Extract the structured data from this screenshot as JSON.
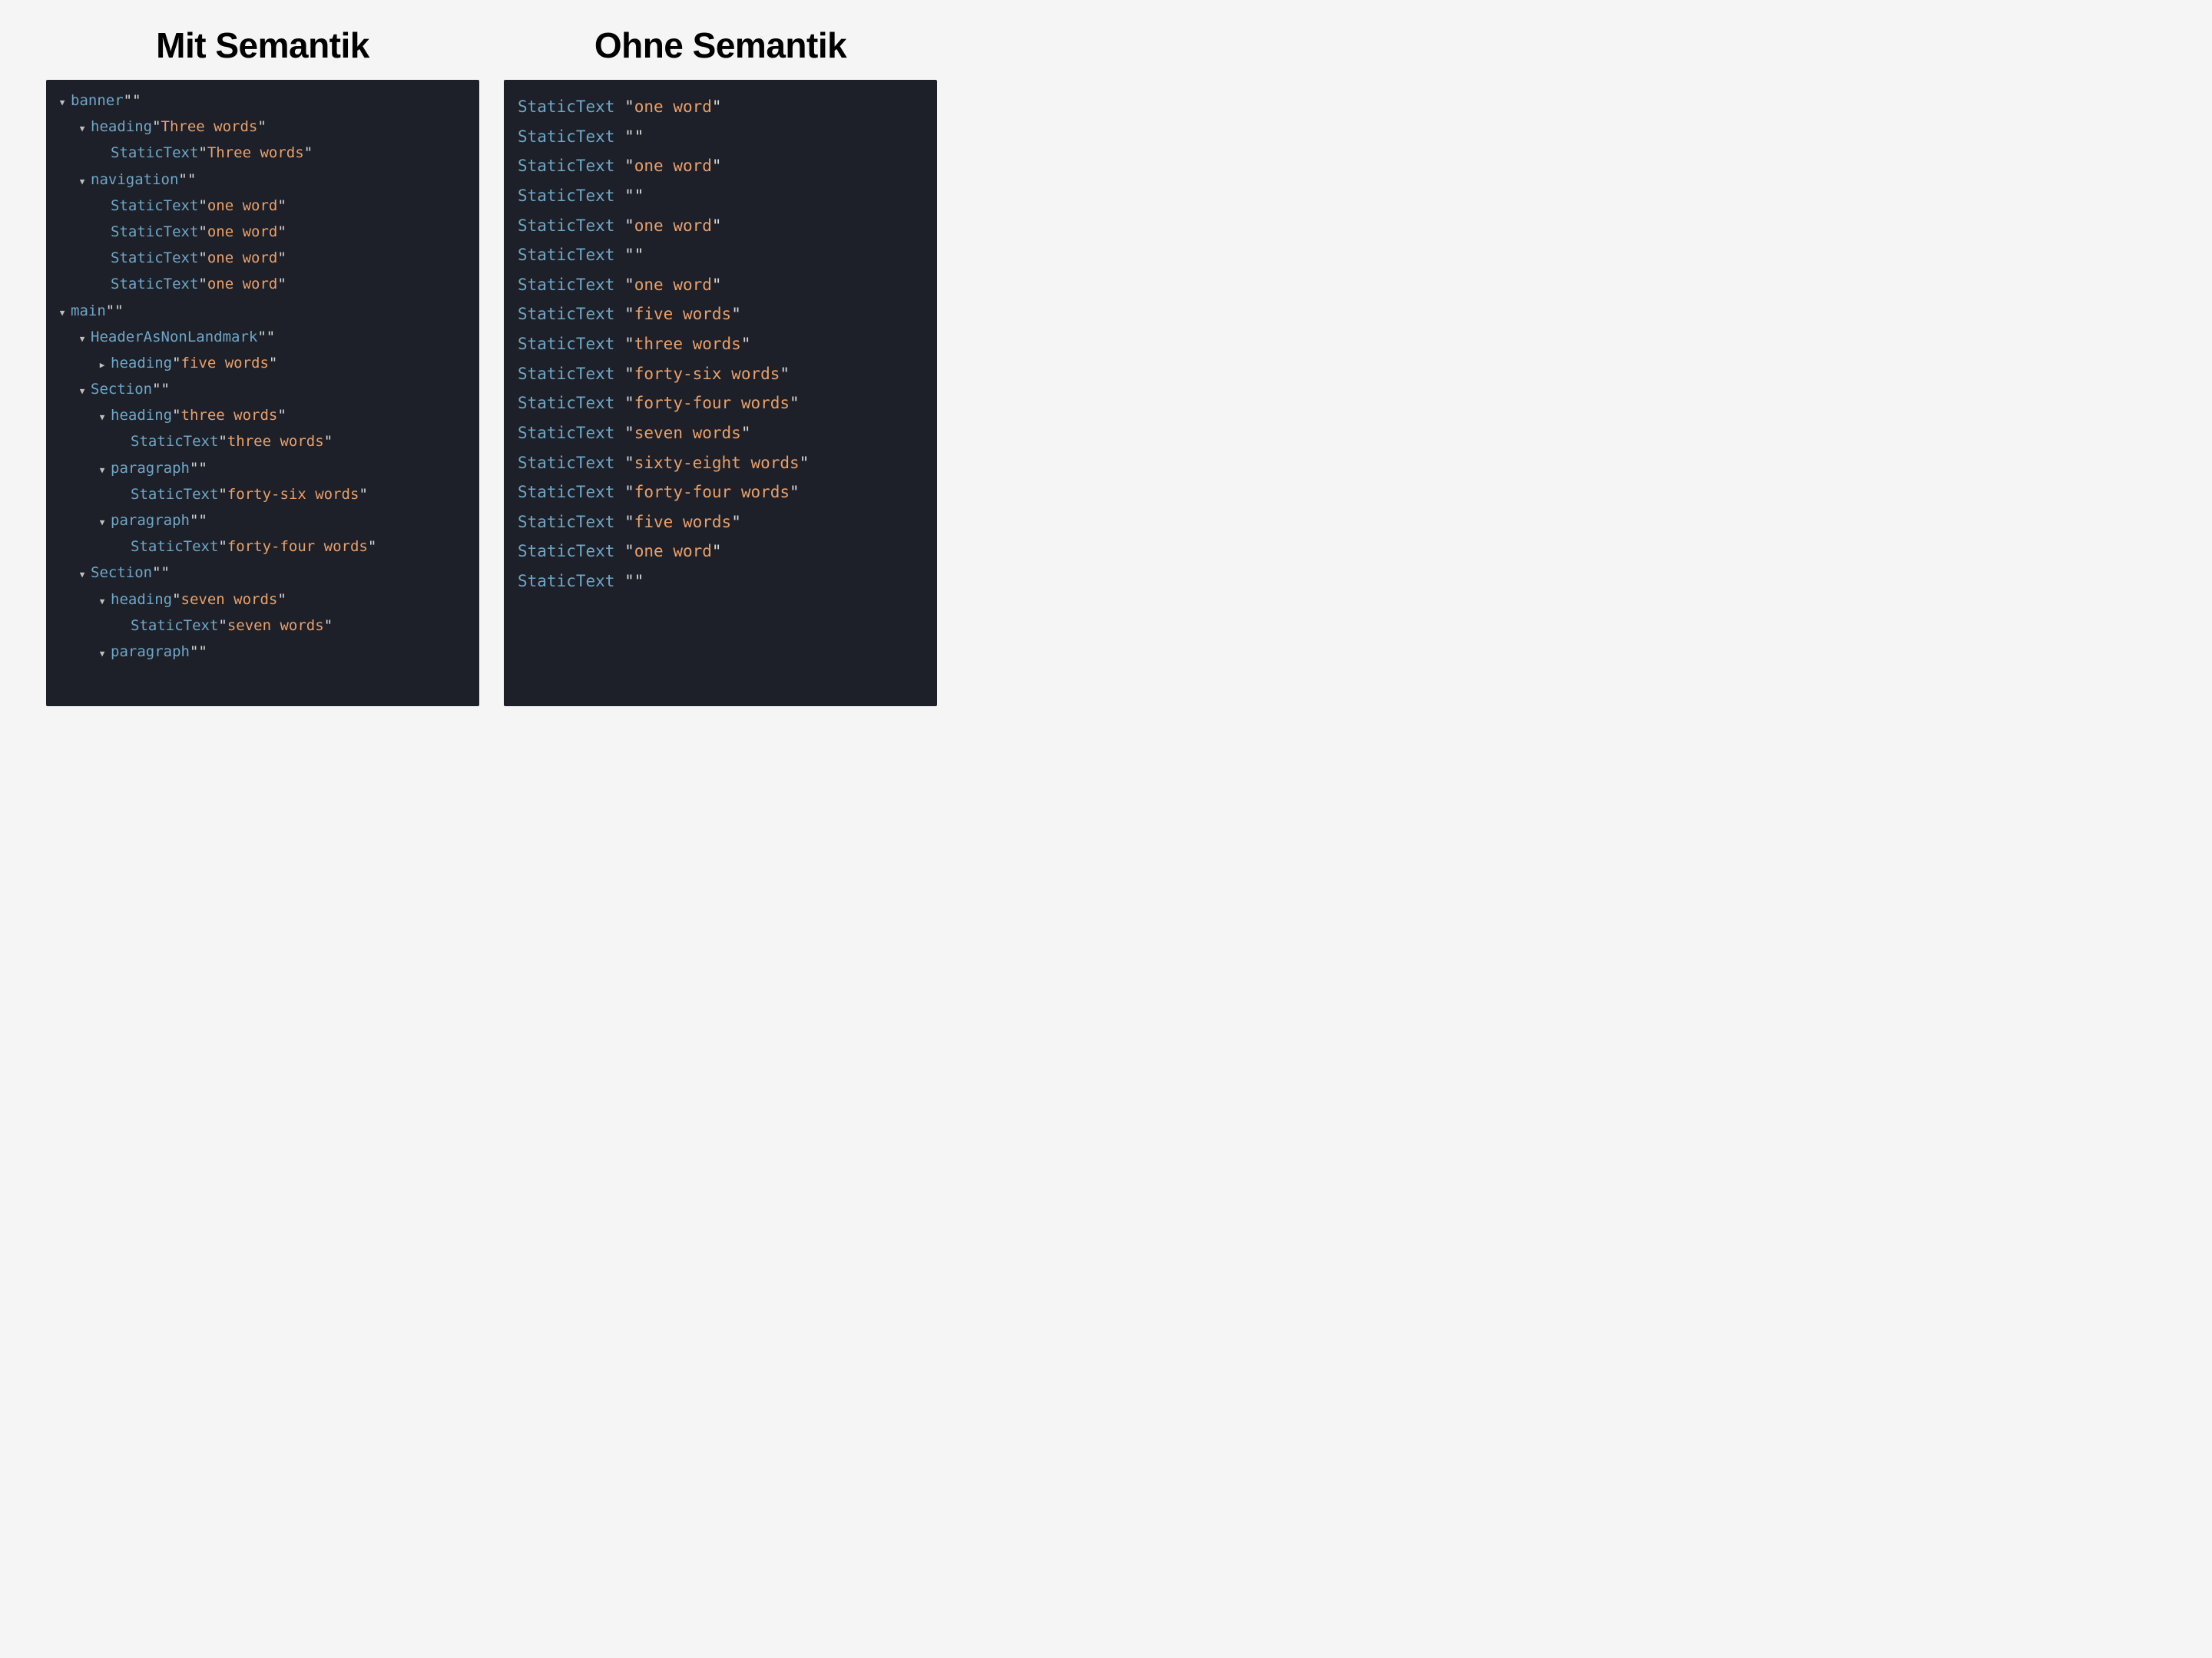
{
  "left": {
    "title": "Mit Semantik",
    "rows": [
      {
        "indent": 0,
        "disclosure": "down",
        "role": "banner",
        "value": ""
      },
      {
        "indent": 1,
        "disclosure": "down",
        "role": "heading",
        "value": "Three words"
      },
      {
        "indent": 2,
        "disclosure": "none",
        "role": "StaticText",
        "value": "Three words"
      },
      {
        "indent": 1,
        "disclosure": "down",
        "role": "navigation",
        "value": ""
      },
      {
        "indent": 2,
        "disclosure": "none",
        "role": "StaticText",
        "value": "one word"
      },
      {
        "indent": 2,
        "disclosure": "none",
        "role": "StaticText",
        "value": "one word"
      },
      {
        "indent": 2,
        "disclosure": "none",
        "role": "StaticText",
        "value": "one word"
      },
      {
        "indent": 2,
        "disclosure": "none",
        "role": "StaticText",
        "value": "one word"
      },
      {
        "indent": 0,
        "disclosure": "down",
        "role": "main",
        "value": ""
      },
      {
        "indent": 1,
        "disclosure": "down",
        "role": "HeaderAsNonLandmark",
        "value": ""
      },
      {
        "indent": 2,
        "disclosure": "right",
        "role": "heading",
        "value": "five words"
      },
      {
        "indent": 1,
        "disclosure": "down",
        "role": "Section",
        "value": ""
      },
      {
        "indent": 2,
        "disclosure": "down",
        "role": "heading",
        "value": "three words"
      },
      {
        "indent": 3,
        "disclosure": "none",
        "role": "StaticText",
        "value": "three words"
      },
      {
        "indent": 2,
        "disclosure": "down",
        "role": "paragraph",
        "value": ""
      },
      {
        "indent": 3,
        "disclosure": "none",
        "role": "StaticText",
        "value": "forty-six words"
      },
      {
        "indent": 2,
        "disclosure": "down",
        "role": "paragraph",
        "value": ""
      },
      {
        "indent": 3,
        "disclosure": "none",
        "role": "StaticText",
        "value": "forty-four words"
      },
      {
        "indent": 1,
        "disclosure": "down",
        "role": "Section",
        "value": ""
      },
      {
        "indent": 2,
        "disclosure": "down",
        "role": "heading",
        "value": "seven words"
      },
      {
        "indent": 3,
        "disclosure": "none",
        "role": "StaticText",
        "value": "seven words"
      },
      {
        "indent": 2,
        "disclosure": "down",
        "role": "paragraph",
        "value": ""
      }
    ]
  },
  "right": {
    "title": "Ohne Semantik",
    "rows": [
      {
        "role": "StaticText",
        "value": "one word"
      },
      {
        "role": "StaticText",
        "value": ""
      },
      {
        "role": "StaticText",
        "value": "one word"
      },
      {
        "role": "StaticText",
        "value": ""
      },
      {
        "role": "StaticText",
        "value": "one word"
      },
      {
        "role": "StaticText",
        "value": ""
      },
      {
        "role": "StaticText",
        "value": "one word"
      },
      {
        "role": "StaticText",
        "value": "five words"
      },
      {
        "role": "StaticText",
        "value": "three words"
      },
      {
        "role": "StaticText",
        "value": "forty-six words"
      },
      {
        "role": "StaticText",
        "value": "forty-four words"
      },
      {
        "role": "StaticText",
        "value": "seven words"
      },
      {
        "role": "StaticText",
        "value": "sixty-eight words"
      },
      {
        "role": "StaticText",
        "value": "forty-four words"
      },
      {
        "role": "StaticText",
        "value": "five words"
      },
      {
        "role": "StaticText",
        "value": "one word"
      },
      {
        "role": "StaticText",
        "value": ""
      }
    ]
  }
}
